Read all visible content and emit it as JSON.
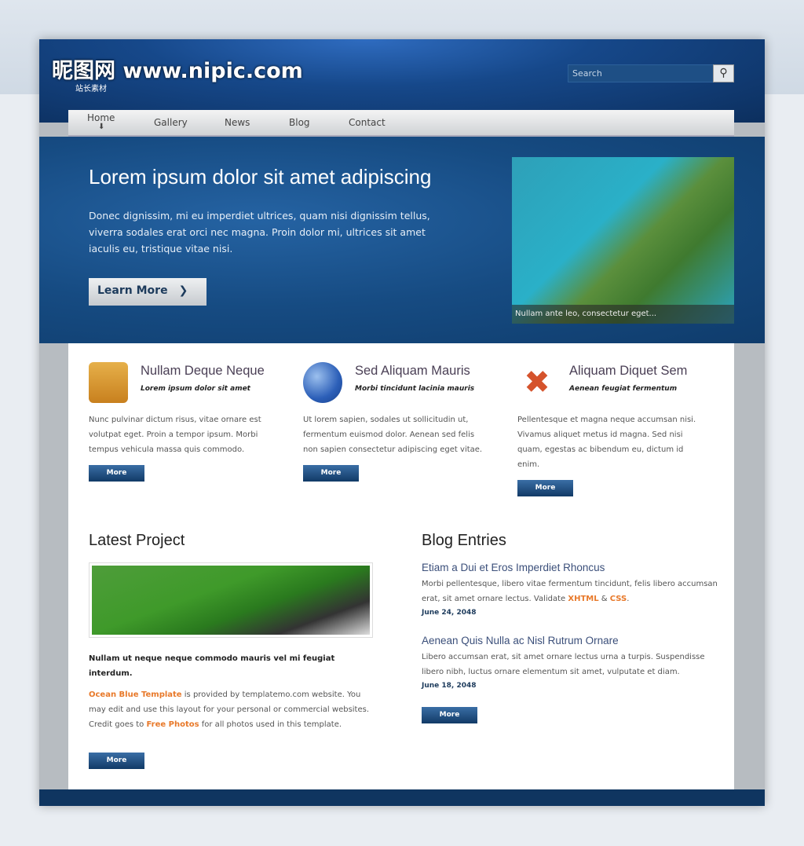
{
  "logo": {
    "text": "昵图网 www.nipic.com",
    "sub": "站长素材"
  },
  "search": {
    "placeholder": "Search"
  },
  "nav": [
    {
      "label": "Home"
    },
    {
      "label": "Gallery"
    },
    {
      "label": "News"
    },
    {
      "label": "Blog"
    },
    {
      "label": "Contact"
    }
  ],
  "hero": {
    "title": "Lorem ipsum dolor sit amet adipiscing",
    "text": "Donec dignissim, mi eu imperdiet ultrices, quam nisi dignissim tellus, viverra sodales erat orci nec magna. Proin dolor mi, ultrices sit amet iaculis eu, tristique vitae nisi.",
    "button": "Learn More",
    "caption": "Nullam ante leo, consectetur eget..."
  },
  "features": [
    {
      "icon": "treasure-chest-icon",
      "title": "Nullam Deque Neque",
      "subtitle": "Lorem ipsum dolor sit amet",
      "text": "Nunc pulvinar dictum risus, vitae ornare est volutpat eget. Proin a tempor ipsum. Morbi tempus vehicula massa quis commodo.",
      "button": "More"
    },
    {
      "icon": "globe-icon",
      "title": "Sed Aliquam Mauris",
      "subtitle": "Morbi tincidunt lacinia mauris",
      "text": "Ut lorem sapien, sodales ut sollicitudin ut, fermentum euismod dolor. Aenean sed felis non sapien consectetur adipiscing eget vitae.",
      "button": "More"
    },
    {
      "icon": "tools-icon",
      "title": "Aliquam Diquet Sem",
      "subtitle": "Aenean feugiat fermentum",
      "text": "Pellentesque et magna neque accumsan nisi. Vivamus aliquet metus id magna. Sed nisi quam, egestas ac bibendum eu, dictum id enim.",
      "button": "More"
    }
  ],
  "project": {
    "heading": "Latest Project",
    "bold": "Nullam ut neque neque commodo mauris vel mi feugiat interdum.",
    "link1": "Ocean Blue Template",
    "text1": " is provided by templatemo.com website. You may edit and use this layout for your personal or commercial websites. Credit goes to ",
    "link2": "Free Photos",
    "text2": " for all photos used in this template.",
    "button": "More"
  },
  "blog": {
    "heading": "Blog Entries",
    "entries": [
      {
        "title": "Etiam a Dui et Eros Imperdiet Rhoncus",
        "text": "Morbi pellentesque, libero vitae fermentum tincidunt, felis libero accumsan erat, sit amet ornare lectus. Validate ",
        "link1": "XHTML",
        "amp": " & ",
        "link2": "CSS",
        "end": ".",
        "date": "June 24, 2048"
      },
      {
        "title": "Aenean Quis Nulla ac Nisl Rutrum Ornare",
        "text": "Libero accumsan erat, sit amet ornare lectus urna a turpis. Suspendisse libero nibh, luctus ornare elementum sit amet, vulputate et diam.",
        "date": "June 18, 2048"
      }
    ],
    "button": "More"
  },
  "colors": {
    "header": "#0c2f5e",
    "hero": "#164b82",
    "link": "#e8792a",
    "button": "#113a66"
  }
}
